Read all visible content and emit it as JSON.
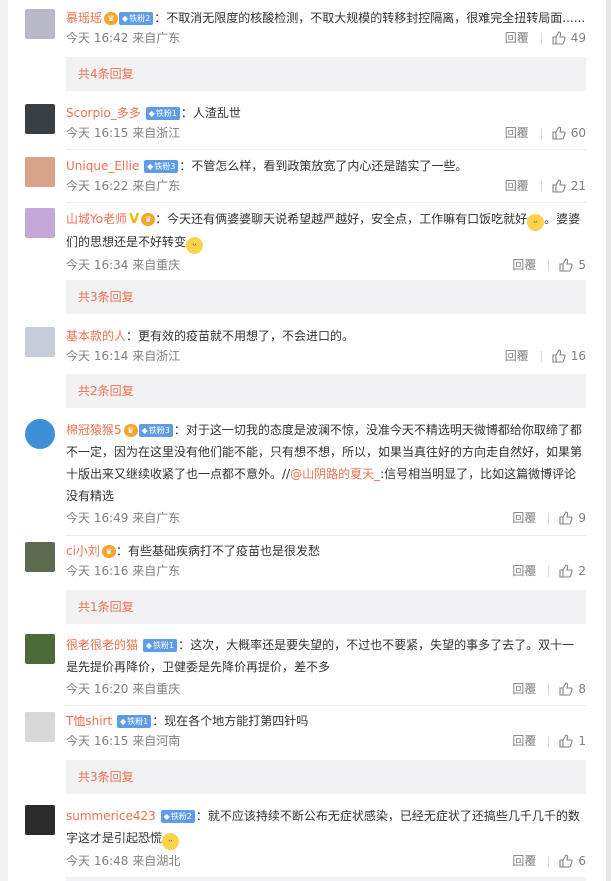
{
  "comments": [
    {
      "user": "慕瑶瑶",
      "vip": true,
      "badge": "铁粉2",
      "text": "：不取消无限度的核酸检测，不取大规模的转移封控隔离，很难完全扭转局面......",
      "time": "今天 16:42 来自广东",
      "reply": "回覆",
      "likes": "49",
      "more": "共4条回复",
      "avatar_color": "#b8b8c8"
    },
    {
      "user": "Scorpio_多多",
      "badge": "铁粉1",
      "text": "：人渣乱世",
      "time": "今天 16:15 来自浙江",
      "reply": "回覆",
      "likes": "60",
      "avatar_color": "#3a3f44"
    },
    {
      "user": "Unique_Ellie",
      "badge": "铁粉3",
      "text": "：不管怎么样，看到政策放宽了内心还是踏实了一些。",
      "time": "今天 16:22 来自广东",
      "reply": "回覆",
      "likes": "21",
      "avatar_color": "#d9a38a"
    },
    {
      "user": "山城Yo老师",
      "verified": "V",
      "vip": true,
      "text_1": "：今天还有俩婆婆聊天说希望越严越好，安全点，工作嘛有口饭吃就好",
      "text_2": "。婆婆们的思想还是不好转变",
      "time": "今天 16:34 来自重庆",
      "reply": "回覆",
      "likes": "5",
      "more": "共3条回复",
      "avatar_color": "#c7a6d8"
    },
    {
      "user": "基本款的人",
      "text": "：更有效的疫苗就不用想了，不会进口的。",
      "time": "今天 16:14 来自浙江",
      "reply": "回覆",
      "likes": "16",
      "more": "共2条回复",
      "avatar_color": "#c6cdd8"
    },
    {
      "user": "棉冠猿猴5",
      "vip": true,
      "badge": "铁粉3",
      "text_1": "：对于这一切我的态度是波澜不惊，没准今天不精选明天微博都给你取缔了都不一定，因为在这里没有他们能不能，只有想不想，所以，如果当真往好的方向走自然好，如果第十版出来又继续收紧了也一点都不意外。//",
      "mention": "@山阴路的夏天_",
      "text_2": ":信号相当明显了，比如这篇微博评论没有精选",
      "time": "今天 16:49 来自广东",
      "reply": "回覆",
      "likes": "9",
      "avatar_color": "#3f8fd6"
    },
    {
      "user": "ci小刘",
      "vip": true,
      "text": "：有些基础疾病打不了疫苗也是很发愁",
      "time": "今天 16:16 来自广东",
      "reply": "回覆",
      "likes": "2",
      "more": "共1条回复",
      "avatar_color": "#5d6b4f"
    },
    {
      "user": "很老很老的猫",
      "badge": "铁粉1",
      "text": "：这次，大概率还是要失望的，不过也不要紧，失望的事多了去了。双十一是先提价再降价，卫健委是先降价再提价，差不多",
      "time": "今天 16:20 来自重庆",
      "reply": "回覆",
      "likes": "8",
      "avatar_color": "#4b6b3a"
    },
    {
      "user": "T恤shirt",
      "badge": "铁粉1",
      "text": "：现在各个地方能打第四针吗",
      "time": "今天 16:15 来自河南",
      "reply": "回覆",
      "likes": "1",
      "more": "共3条回复",
      "avatar_color": "#d8d8d8"
    },
    {
      "user": "summerice423",
      "badge": "铁粉2",
      "text_1": "：就不应该持续不断公布无症状感染，已经无症状了还搞些几千几千的数字这才是引起恐慌",
      "time": "今天 16:48 来自湖北",
      "reply": "回覆",
      "likes": "6",
      "avatar_color": "#2a2a2a"
    }
  ]
}
